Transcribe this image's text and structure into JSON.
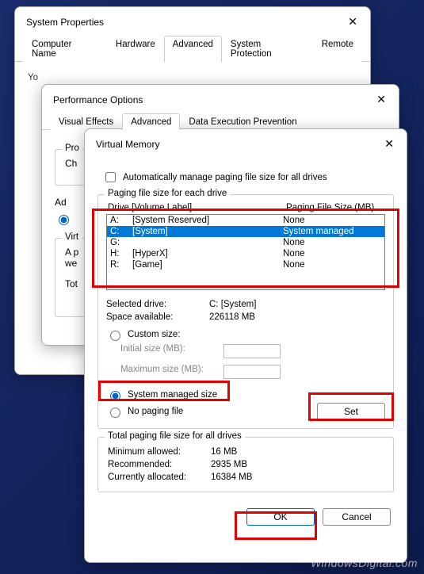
{
  "sysProps": {
    "title": "System Properties",
    "tabs": [
      "Computer Name",
      "Hardware",
      "Advanced",
      "System Protection",
      "Remote"
    ],
    "activeTab": "Advanced",
    "bodyPrefix": "Yo"
  },
  "perfOpts": {
    "title": "Performance Options",
    "tabs": [
      "Visual Effects",
      "Advanced",
      "Data Execution Prevention"
    ],
    "activeTab": "Advanced",
    "group1Legend": "Pro",
    "group1Line": "Ch",
    "label2": "Ad",
    "group3Legend": "Virt",
    "group3Line1": "A p",
    "group3Line2": "we",
    "group3Line3": "Tot"
  },
  "vm": {
    "title": "Virtual Memory",
    "autoManageLabel": "Automatically manage paging file size for all drives",
    "autoManageChecked": false,
    "groupLegend": "Paging file size for each drive",
    "header": {
      "col1": "Drive  [Volume Label]",
      "col2": "Paging File Size (MB)"
    },
    "drives": [
      {
        "letter": "A:",
        "label": "[System Reserved]",
        "size": "None",
        "selected": false
      },
      {
        "letter": "C:",
        "label": "[System]",
        "size": "System managed",
        "selected": true
      },
      {
        "letter": "G:",
        "label": "",
        "size": "None",
        "selected": false
      },
      {
        "letter": "H:",
        "label": "[HyperX]",
        "size": "None",
        "selected": false
      },
      {
        "letter": "R:",
        "label": "[Game]",
        "size": "None",
        "selected": false
      }
    ],
    "selectedDriveLabel": "Selected drive:",
    "selectedDriveValue": "C:  [System]",
    "spaceAvailLabel": "Space available:",
    "spaceAvailValue": "226118 MB",
    "optCustom": "Custom size:",
    "initialSizeLabel": "Initial size (MB):",
    "maxSizeLabel": "Maximum size (MB):",
    "optSystemManaged": "System managed size",
    "optNoPaging": "No paging file",
    "selectedOption": "system",
    "setBtn": "Set",
    "totalsLegend": "Total paging file size for all drives",
    "minAllowedLabel": "Minimum allowed:",
    "minAllowedValue": "16 MB",
    "recommendedLabel": "Recommended:",
    "recommendedValue": "2935 MB",
    "currAllocLabel": "Currently allocated:",
    "currAllocValue": "16384 MB",
    "okBtn": "OK",
    "cancelBtn": "Cancel"
  },
  "watermark": "WindowsDigital.com"
}
